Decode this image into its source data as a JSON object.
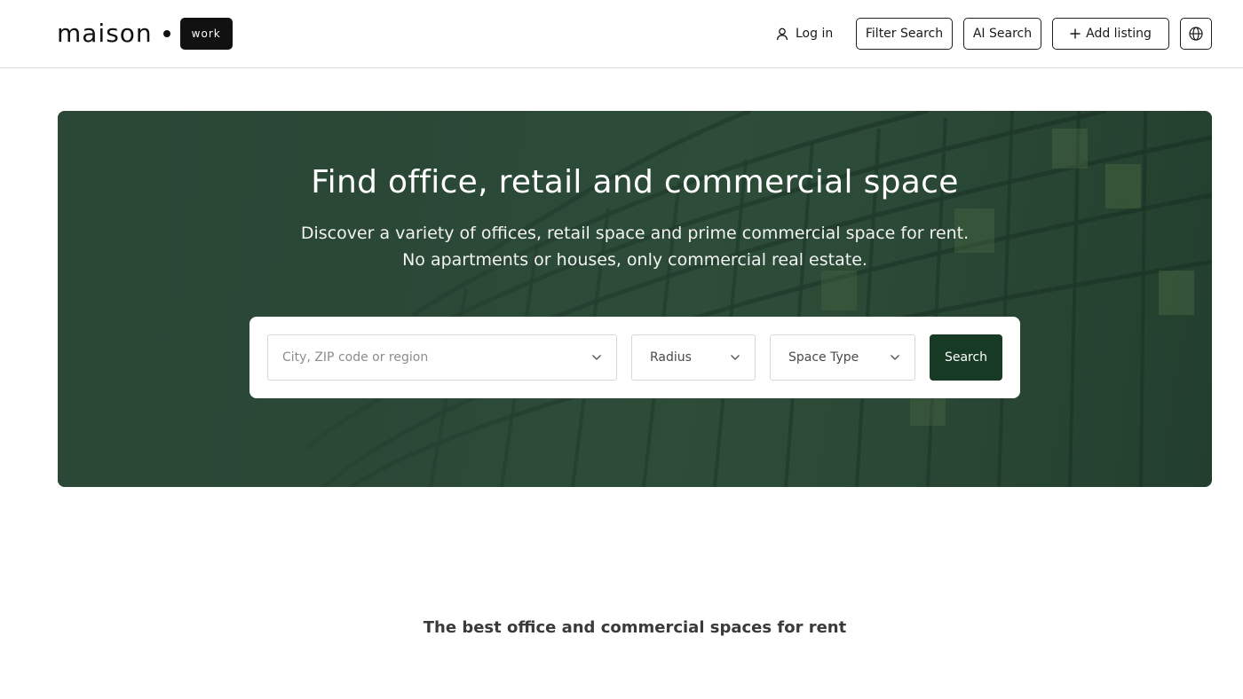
{
  "header": {
    "logo": {
      "word": "maison",
      "badge": "work"
    },
    "login_label": "Log in",
    "filter_search_label": "Filter Search",
    "ai_search_label": "AI Search",
    "add_listing_label": "Add listing",
    "icons": {
      "login": "user-icon",
      "add": "plus-icon",
      "language": "globe-icon"
    }
  },
  "hero": {
    "title": "Find office, retail and commercial space",
    "subtitle_line1": "Discover a variety of offices, retail space and prime commercial space for rent.",
    "subtitle_line2": "No apartments or houses, only commercial real estate.",
    "background": "office-building-glass-facade",
    "tint_color": "#2f4d3b"
  },
  "search": {
    "location_placeholder": "City, ZIP code or region",
    "radius_label": "Radius",
    "space_type_label": "Space Type",
    "button_label": "Search",
    "button_color": "#173a24"
  },
  "section": {
    "heading": "The best office and commercial spaces for rent"
  }
}
